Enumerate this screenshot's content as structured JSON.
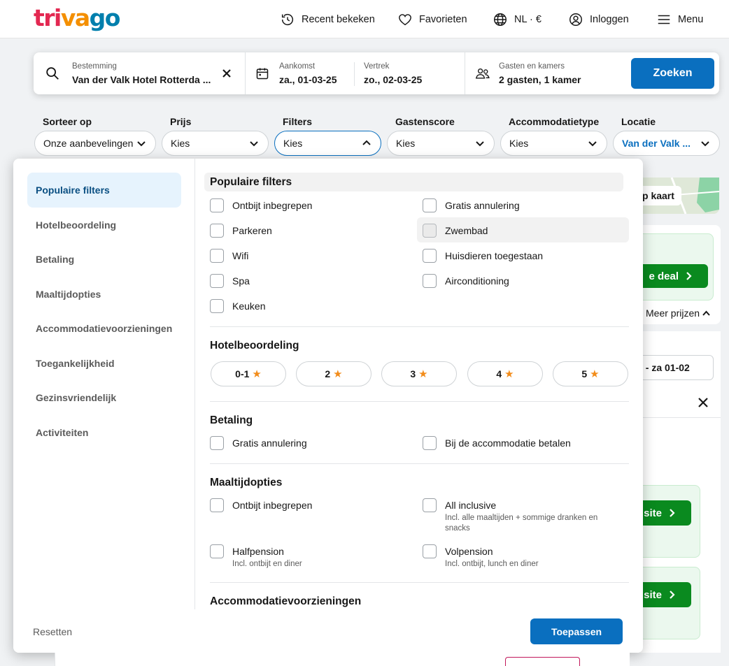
{
  "header": {
    "logo_text": "trivago",
    "nav": {
      "recent": "Recent bekeken",
      "favorites": "Favorieten",
      "locale": "NL · €",
      "login": "Inloggen",
      "menu": "Menu"
    }
  },
  "search": {
    "destination_label": "Bestemming",
    "destination_value": "Van der Valk Hotel Rotterda ...",
    "checkin_label": "Aankomst",
    "checkin_value": "za., 01-03-25",
    "checkout_label": "Vertrek",
    "checkout_value": "zo., 02-03-25",
    "guests_label": "Gasten en kamers",
    "guests_value": "2 gasten, 1 kamer",
    "search_button": "Zoeken"
  },
  "filter_bar": [
    {
      "label": "Sorteer op",
      "value": "Onze aanbevelingen"
    },
    {
      "label": "Prijs",
      "value": "Kies"
    },
    {
      "label": "Filters",
      "value": "Kies"
    },
    {
      "label": "Gastenscore",
      "value": "Kies"
    },
    {
      "label": "Accommodatietype",
      "value": "Kies"
    },
    {
      "label": "Locatie",
      "value": "Van der Valk ..."
    }
  ],
  "background": {
    "map_button": "p kaart",
    "deal_button": "e deal",
    "more_prices": "Meer prijzen",
    "date_range": "l - za 01-02",
    "site_button": "e site"
  },
  "panel": {
    "sidebar": [
      "Populaire filters",
      "Hotelbeoordeling",
      "Betaling",
      "Maaltijdopties",
      "Accommodatievoorzieningen",
      "Toegankelijkheid",
      "Gezinsvriendelijk",
      "Activiteiten"
    ],
    "popular": {
      "title": "Populaire filters",
      "left": [
        "Ontbijt inbegrepen",
        "Parkeren",
        "Wifi",
        "Spa",
        "Keuken"
      ],
      "right": [
        "Gratis annulering",
        "Zwembad",
        "Huisdieren toegestaan",
        "Airconditioning"
      ]
    },
    "rating": {
      "title": "Hotelbeoordeling",
      "options": [
        "0-1",
        "2",
        "3",
        "4",
        "5"
      ]
    },
    "payment": {
      "title": "Betaling",
      "options": [
        "Gratis annulering",
        "Bij de accommodatie betalen"
      ]
    },
    "meals": {
      "title": "Maaltijdopties",
      "options": [
        {
          "label": "Ontbijt inbegrepen",
          "sub": ""
        },
        {
          "label": "All inclusive",
          "sub": "Incl. alle maaltijden + sommige dranken en snacks"
        },
        {
          "label": "Halfpension",
          "sub": "Incl. ontbijt en diner"
        },
        {
          "label": "Volpension",
          "sub": "Incl. ontbijt, lunch en diner"
        }
      ]
    },
    "facilities": {
      "title": "Accommodatievoorzieningen"
    },
    "footer": {
      "reset": "Resetten",
      "apply": "Toepassen"
    }
  },
  "colors": {
    "accent": "#0a6fbf",
    "deal_green": "#0a8a1f",
    "star": "#f28c1a"
  }
}
